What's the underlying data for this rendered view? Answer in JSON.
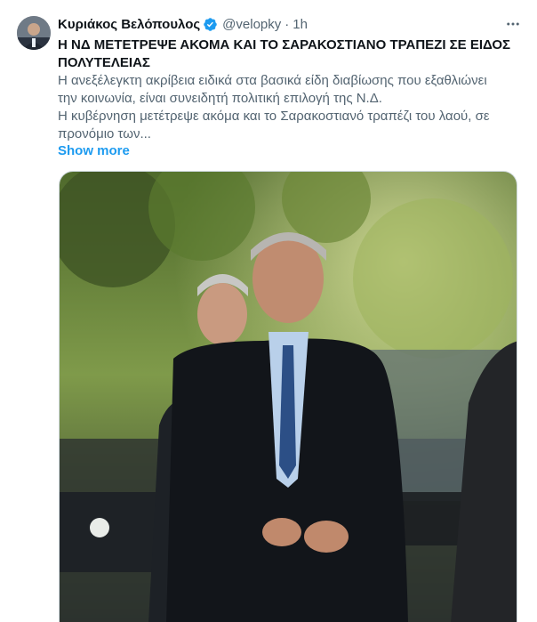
{
  "tweet": {
    "author_name": "Κυριάκος Βελόπουλος",
    "handle": "@velopky",
    "separator": "·",
    "time": "1h",
    "headline_lines": [
      "Η ΝΔ ΜΕΤΕΤΡΕΨΕ ΑΚΟΜΑ ΚΑΙ ΤΟ ΣΑΡΑΚΟΣΤΙΑΝΟ ΤΡΑΠΕΖΙ ΣΕ ΕΙΔΟΣ",
      "ΠΟΛΥΤΕΛΕΙΑΣ"
    ],
    "body_lines": [
      "Η ανεξέλεγκτη ακρίβεια ειδικά στα βασικά είδη διαβίωσης που εξαθλιώνει",
      "την κοινωνία, είναι συνειδητή πολιτική επιλογή της Ν.Δ.",
      "Η κυβέρνηση μετέτρεψε ακόμα και το Σαρακοστιανό τραπέζι του λαού, σε",
      "προνόμιο των..."
    ],
    "show_more": "Show more",
    "accent_color": "#1d9bf0",
    "verified_icon": "verified-badge-icon",
    "more_icon": "more-options-icon"
  }
}
